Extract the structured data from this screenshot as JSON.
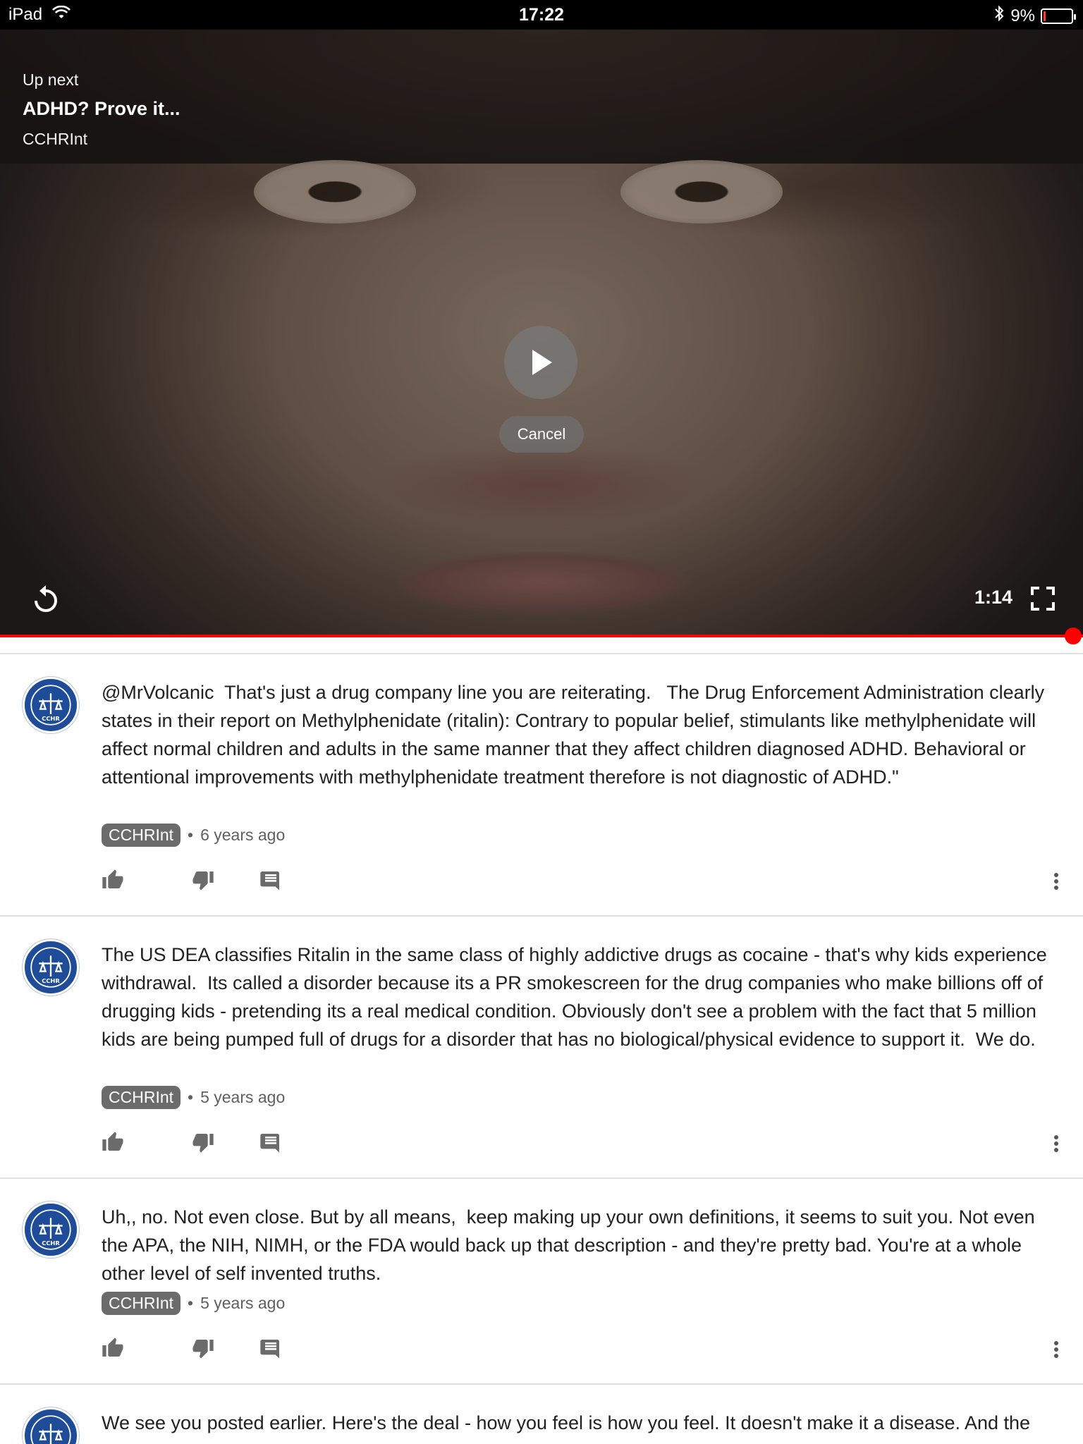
{
  "status_bar": {
    "device": "iPad",
    "time": "17:22",
    "battery": "9%",
    "battery_level": 0.09
  },
  "player": {
    "up_next_label": "Up next",
    "up_next_title": "ADHD? Prove it...",
    "up_next_channel": "CCHRInt",
    "cancel_label": "Cancel",
    "timecode": "1:14",
    "progress": 1.0,
    "accent_color": "#ff0000"
  },
  "comments": [
    {
      "text": "@MrVolcanic  That's just a drug company line you are reiterating.   The Drug Enforcement Administration clearly states in their report on Methylphenidate (ritalin): Contrary to popular belief, stimulants like methylphenidate will affect normal children and adults in the same manner that they affect children diagnosed ADHD. Behavioral or attentional improvements with methylphenidate treatment therefore is not diagnostic of ADHD.\"",
      "author": "CCHRInt",
      "time": "6 years ago"
    },
    {
      "text": "The US DEA classifies Ritalin in the same class of highly addictive drugs as cocaine - that's why kids experience withdrawal.  Its called a disorder because its a PR smokescreen for the drug companies who make billions off of drugging kids - pretending its a real medical condition. Obviously don't see a problem with the fact that 5 million kids are being pumped full of drugs for a disorder that has no biological/physical evidence to support it.  We do.",
      "author": "CCHRInt",
      "time": "5 years ago"
    },
    {
      "text": "Uh,, no. Not even close. But by all means,  keep making up your own definitions, it seems to suit you. Not even the APA, the NIH, NIMH, or the FDA would back up that description - and they're pretty bad. You're at a whole other level of self invented truths.",
      "author": "CCHRInt",
      "time": "5 years ago"
    },
    {
      "text": "We see you posted earlier. Here's the deal - how you feel is how you feel. It doesn't make it a disease.  And the",
      "author": "",
      "time": ""
    }
  ]
}
